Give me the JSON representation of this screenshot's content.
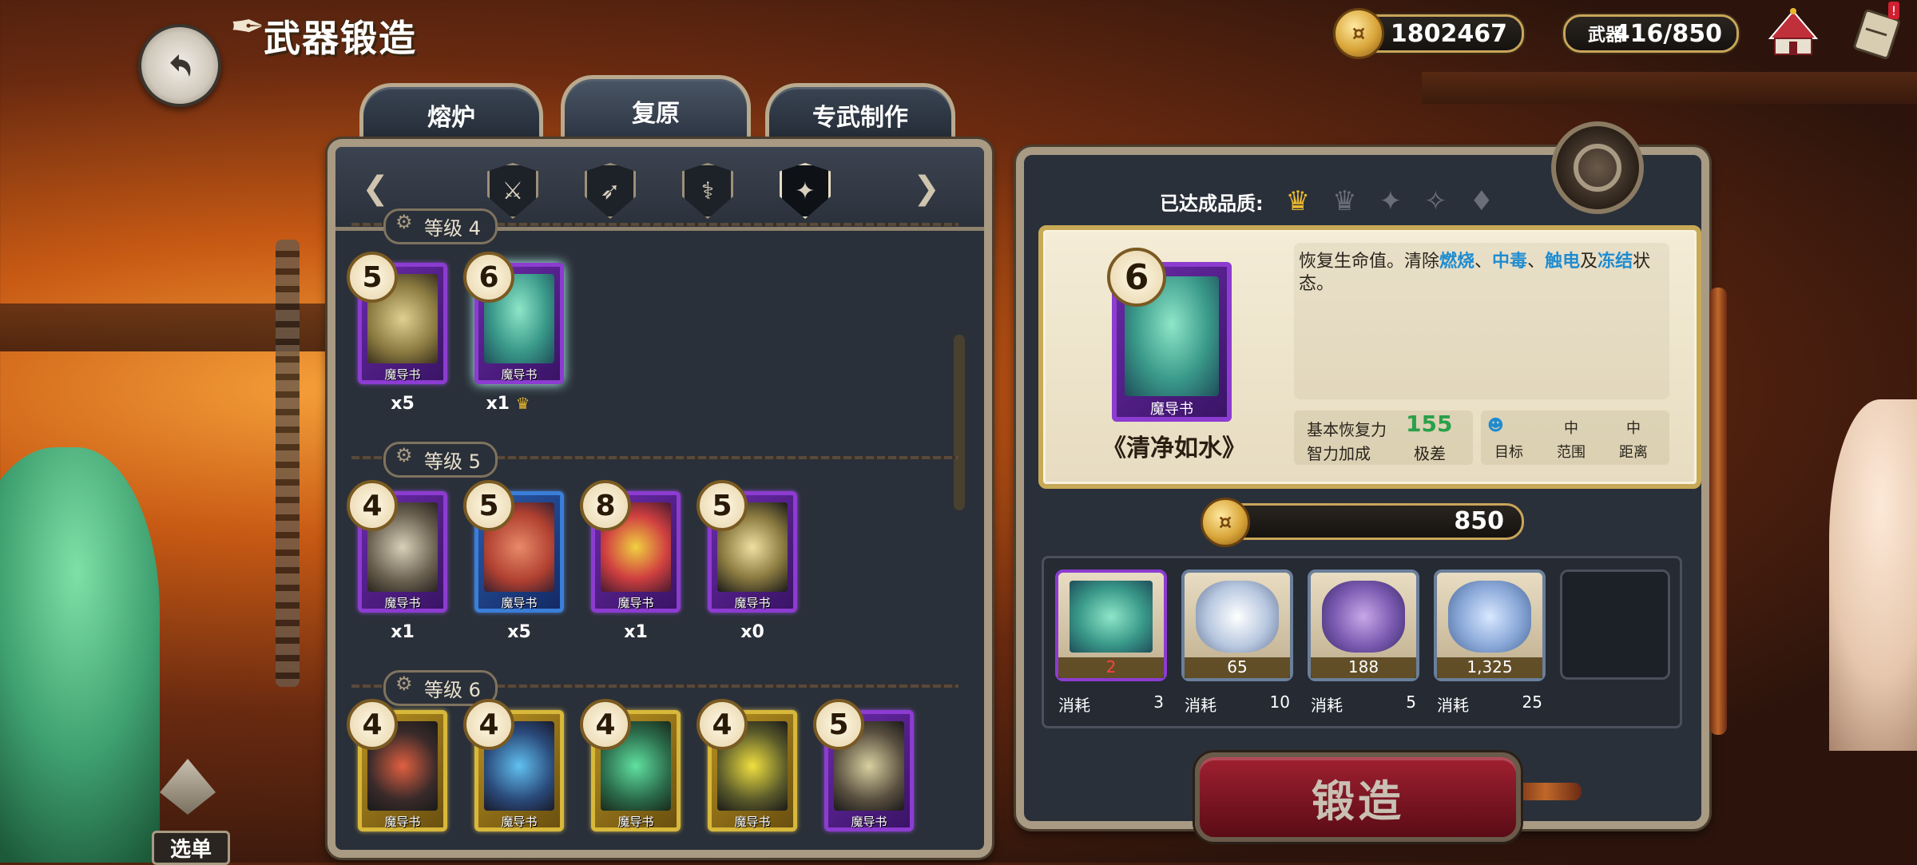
{
  "header": {
    "title": "武器锻造",
    "gold": "1802467",
    "weapon_label": "武器",
    "weapon_count": "416/850"
  },
  "tabs": [
    {
      "label": "熔炉"
    },
    {
      "label": "复原"
    },
    {
      "label": "专武制作"
    }
  ],
  "filters": [
    "sword-filter",
    "bow-filter",
    "staff-filter",
    "grimoire-filter"
  ],
  "levels": [
    "等级 4",
    "等级 5",
    "等级 6"
  ],
  "cards": {
    "level4": [
      {
        "level": "5",
        "name": "魔导书",
        "count": "x5"
      },
      {
        "level": "6",
        "name": "魔导书",
        "count": "x1"
      }
    ],
    "level5": [
      {
        "level": "4",
        "name": "魔导书",
        "count": "x1"
      },
      {
        "level": "5",
        "name": "魔导书",
        "count": "x5"
      },
      {
        "level": "8",
        "name": "魔导书",
        "count": "x1"
      },
      {
        "level": "5",
        "name": "魔导书",
        "count": "x0"
      }
    ],
    "level6": [
      {
        "level": "4",
        "name": "魔导书"
      },
      {
        "level": "4",
        "name": "魔导书"
      },
      {
        "level": "4",
        "name": "魔导书"
      },
      {
        "level": "4",
        "name": "魔导书"
      },
      {
        "level": "5",
        "name": "魔导书"
      }
    ]
  },
  "detail": {
    "quality_label": "已达成品质:",
    "level": "6",
    "card_name": "魔导书",
    "weapon_name": "《清净如水》",
    "desc_parts": [
      "恢复生命值。清除",
      "燃烧",
      "、",
      "中毒",
      "、",
      "触电",
      "及",
      "冻结",
      "状态。"
    ],
    "stat1_label": "基本恢复力",
    "stat1_value": "155",
    "stat2_label": "智力加成",
    "stat2_value": "极差",
    "attr_range_val": "中",
    "attr_dist_val": "中",
    "attr_target": "目标",
    "attr_range": "范围",
    "attr_dist": "距离"
  },
  "cost": "850",
  "materials": [
    {
      "num": "2",
      "label": "消耗",
      "need": "3"
    },
    {
      "num": "65",
      "label": "消耗",
      "need": "10"
    },
    {
      "num": "188",
      "label": "消耗",
      "need": "5"
    },
    {
      "num": "1,325",
      "label": "消耗",
      "need": "25"
    }
  ],
  "forge_label": "锻造",
  "menu_label": "选单",
  "colors": {
    "accent_gold": "#c9a55a",
    "highlight_blue": "#1f8cd0",
    "forge_red": "#a02030"
  }
}
